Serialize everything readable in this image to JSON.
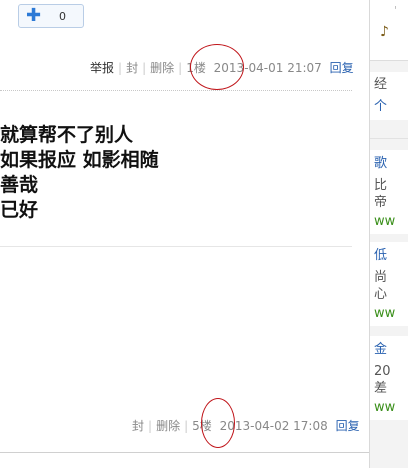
{
  "like": {
    "count": "0"
  },
  "floor1": {
    "report": "举报",
    "block": "封",
    "delete": "删除",
    "floor": "1楼",
    "time": "2013-04-01 21:07",
    "reply": "回复"
  },
  "post_lines": [
    "就算帮不了别人",
    "如果报应 如影相随",
    "善哉",
    "已好"
  ],
  "floor5": {
    "block": "封",
    "delete": "删除",
    "floor": "5楼",
    "time": "2013-04-02 17:08",
    "reply": "回复"
  },
  "sidebar": {
    "top_lines": [
      "经",
      "个"
    ],
    "items": [
      {
        "title": "歌",
        "desc1": "比",
        "desc2": "帝",
        "url": "ww"
      },
      {
        "title": "低",
        "desc1": "尚",
        "desc2": "心",
        "url": "ww"
      },
      {
        "title": "金",
        "desc1": "20",
        "desc2": "差",
        "url": "ww"
      }
    ]
  },
  "annotation_color": "#c0151a",
  "link_color": "#2a62b0"
}
